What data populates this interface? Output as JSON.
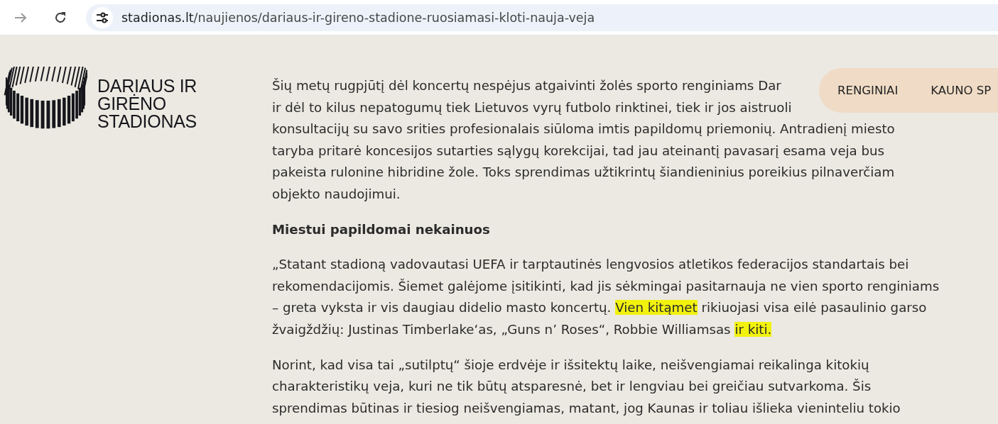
{
  "browser": {
    "url_host": "stadionas.lt",
    "url_path": "/naujienos/dariaus-ir-gireno-stadione-ruosiamasi-kloti-nauja-veja"
  },
  "logo": {
    "lines": [
      "DARIAUS IR",
      "GIRĖNO",
      "STADIONAS"
    ]
  },
  "nav": {
    "items": [
      "RENGINIAI",
      "KAUNO SP"
    ]
  },
  "article": {
    "blocks": [
      {
        "kind": "paragraph",
        "lines": [
          [
            {
              "text": "Šių metų rugpjūtį dėl koncertų nespėjus atgaivinti žolės sporto renginiams Dar",
              "highlighted": false
            }
          ],
          [
            {
              "text": "ir dėl to kilus nepatogumų tiek Lietuvos vyrų futbolo rinktinei, tiek ir jos aistruoli",
              "highlighted": false
            }
          ],
          [
            {
              "text": "konsultacijų su savo srities profesionalais siūloma imtis papildomų priemonių. Antradienį miesto",
              "highlighted": false
            }
          ],
          [
            {
              "text": "taryba pritarė koncesijos sutarties sąlygų korekcijai, tad jau ateinantį pavasarį esama veja bus",
              "highlighted": false
            }
          ],
          [
            {
              "text": "pakeista rulonine hibridine žole. Toks sprendimas užtikrintų šiandieninius poreikius pilnaverčiam",
              "highlighted": false
            }
          ],
          [
            {
              "text": "objekto naudojimui.",
              "highlighted": false
            }
          ]
        ]
      },
      {
        "kind": "heading",
        "text": "Miestui papildomai nekainuos"
      },
      {
        "kind": "paragraph",
        "lines": [
          [
            {
              "text": "„Statant stadioną vadovautasi UEFA ir tarptautinės lengvosios atletikos federacijos standartais bei",
              "highlighted": false
            }
          ],
          [
            {
              "text": "rekomendacijomis. Šiemet galėjome įsitikinti, kad jis sėkmingai pasitarnauja ne vien sporto renginiams",
              "highlighted": false
            }
          ],
          [
            {
              "text": "– greta vyksta ir vis daugiau didelio masto koncertų. ",
              "highlighted": false
            },
            {
              "text": "Vien kitąmet",
              "highlighted": true
            },
            {
              "text": " rikiuojasi visa eilė pasaulinio garso",
              "highlighted": false
            }
          ],
          [
            {
              "text": "žvaigždžių: Justinas Timberlake‘as, „Guns n’ Roses“, Robbie Williamsas ",
              "highlighted": false
            },
            {
              "text": "ir kiti.",
              "highlighted": true
            }
          ]
        ]
      },
      {
        "kind": "paragraph",
        "lines": [
          [
            {
              "text": "Norint, kad visa tai „sutilptų“ šioje erdvėje ir išsitektų laike, neišvengiamai reikalinga kitokių",
              "highlighted": false
            }
          ],
          [
            {
              "text": "charakteristikų veja, kuri ne tik būtų atsparesnė, bet ir lengviau bei greičiau sutvarkoma. Šis",
              "highlighted": false
            }
          ],
          [
            {
              "text": "sprendimas būtinas ir tiesiog neišvengiamas, matant, jog Kaunas ir toliau išlieka vieninteliu tokio",
              "highlighted": false
            }
          ]
        ]
      }
    ]
  }
}
